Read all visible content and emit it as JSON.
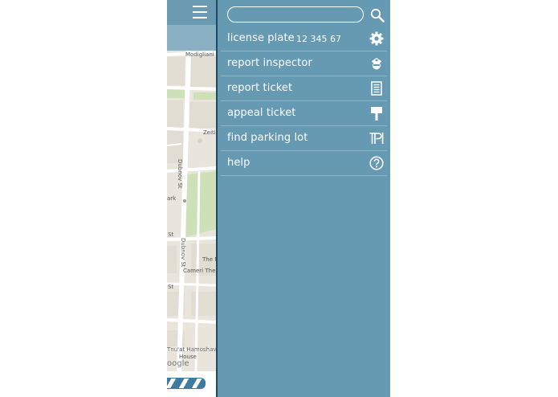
{
  "map": {
    "labels": {
      "modigliani": "Modigliani St",
      "zeitlin": "Zeitl",
      "dubnov_1": "Dubnov St",
      "dubnov_2": "Dubnov St",
      "park": "ark",
      "st_1": "St",
      "st_2": "St",
      "the_n": "The N",
      "cameri": "Cameri Theate",
      "tnua": "Tnu'at Hamoshavim",
      "house": "House"
    },
    "google_mark": "oogle"
  },
  "search": {
    "placeholder": "",
    "value": ""
  },
  "menu": {
    "items": [
      {
        "label": "license plate",
        "value": "12 345 67",
        "icon": "gear-icon"
      },
      {
        "label": "report inspector",
        "icon": "inspector-icon"
      },
      {
        "label": "report ticket",
        "icon": "ticket-icon"
      },
      {
        "label": "appeal ticket",
        "icon": "sign-icon"
      },
      {
        "label": "find parking lot",
        "icon": "parking-icon"
      },
      {
        "label": "help",
        "icon": "help-icon"
      }
    ]
  },
  "colors": {
    "menu_bg": "#6699b2",
    "menu_border": "#1e4a62",
    "divider": "#8fb6c9",
    "map_bg": "#e9e5dc",
    "park": "#cde0b7"
  }
}
